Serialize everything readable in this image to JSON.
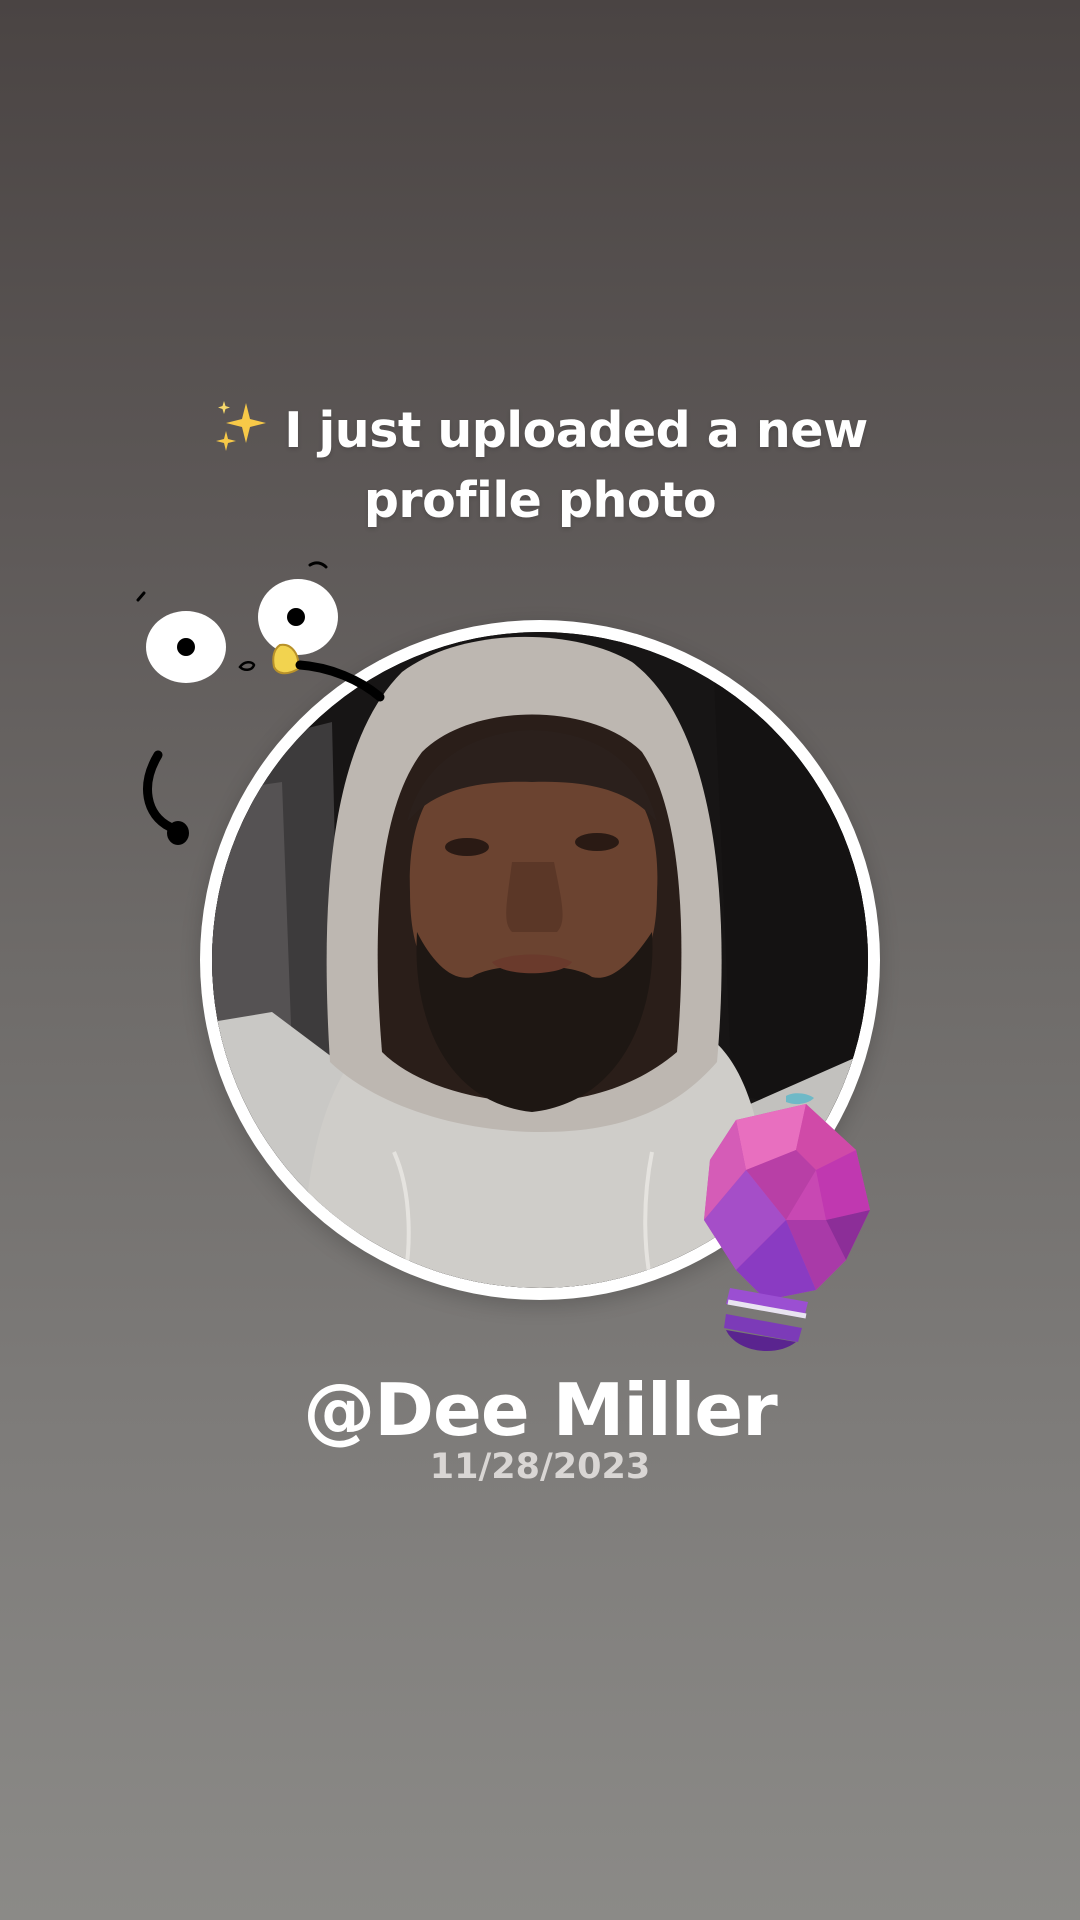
{
  "post": {
    "sparkle_icon": "sparkles-icon",
    "headline": "I just uploaded a new profile photo",
    "username": "@Dee Miller",
    "date": "11/28/2023"
  },
  "stickers": {
    "face_doodle": "cartoon-face-sticker",
    "lightbulb": "lightbulb-sticker"
  },
  "colors": {
    "background_top": "#4a4443",
    "background_bottom": "#8b8a87",
    "ring": "#ffffff",
    "text": "#ffffff",
    "date_text": "#d9d6d4",
    "bulb_purple": "#a23cc9",
    "bulb_pink": "#e05bb8"
  }
}
